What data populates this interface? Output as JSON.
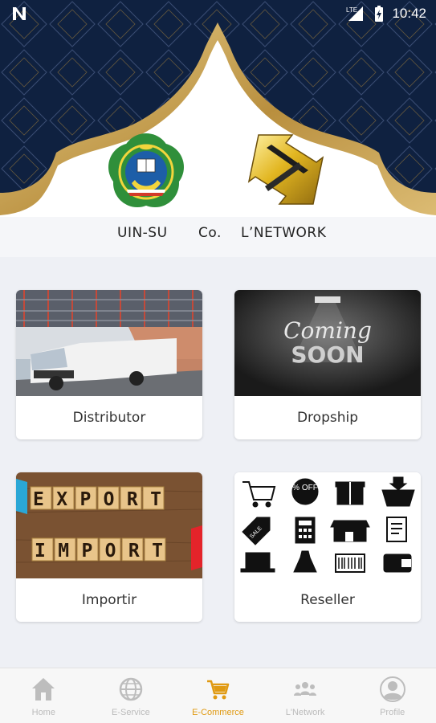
{
  "status_bar": {
    "time": "10:42",
    "network_label": "LTE",
    "icons": [
      "notification-n-icon",
      "signal-icon",
      "battery-icon"
    ]
  },
  "header": {
    "brand_left": "UIN-SU",
    "brand_middle": "Co.",
    "brand_right": "L’NETWORK",
    "logo_left": "uin-su-emblem",
    "logo_right": "lnetwork-emblem"
  },
  "cards": [
    {
      "label": "Distributor",
      "image": "truck-warehouse-image"
    },
    {
      "label": "Dropship",
      "image": "coming-soon-image",
      "image_text_top": "Coming",
      "image_text_bottom": "SOON"
    },
    {
      "label": "Importir",
      "image": "export-import-blocks-image",
      "image_text_top": "EXPORT",
      "image_text_bottom": "IMPORT"
    },
    {
      "label": "Reseller",
      "image": "shopping-icons-grid-image",
      "badge_text": "% OFF",
      "tag_text": "SALE"
    }
  ],
  "bottom_nav": {
    "items": [
      {
        "label": "Home",
        "icon": "home-icon",
        "active": false
      },
      {
        "label": "E-Service",
        "icon": "globe-icon",
        "active": false
      },
      {
        "label": "E-Commerce",
        "icon": "cart-icon",
        "active": true
      },
      {
        "label": "L'Network",
        "icon": "people-icon",
        "active": false
      },
      {
        "label": "Profile",
        "icon": "profile-icon",
        "active": false
      }
    ]
  },
  "colors": {
    "header_bg": "#0f2140",
    "arch_gold": "#c9a65a",
    "page_bg": "#eef0f5",
    "accent_active": "#e09a12",
    "nav_inactive": "#bbbbbb"
  }
}
